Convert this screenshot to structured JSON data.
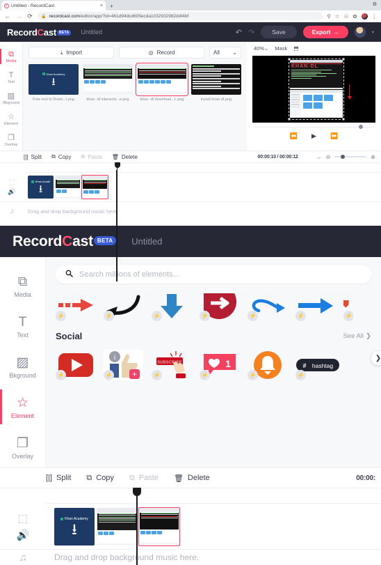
{
  "browser": {
    "tab": {
      "title": "Untitled - RecordCast",
      "favicon": "recordcast-favicon",
      "close": "×"
    },
    "new_tab": "+",
    "window_control": "⚙",
    "nav": {
      "back": "←",
      "forward": "→",
      "reload": "⟳"
    },
    "omnibox": {
      "lock_icon": "🔒",
      "url_prefix": "recordcast.com",
      "url_suffix": "/editor/app/?id=461d94dcd605ecda1032932982d4f4bf"
    },
    "toolbar_icons": [
      "key-icon",
      "star-icon",
      "person-icon",
      "extensions-icon",
      "profile-avatar",
      "more-menu-icon"
    ]
  },
  "header": {
    "logo_pre": "Record",
    "logo_c": "C",
    "logo_post": "ast",
    "beta": "BETA",
    "project_title": "Untitled",
    "undo_icon": "↶",
    "redo_icon": "↷",
    "save_label": "Save",
    "export_label": "Export",
    "export_arrow": "→",
    "avatar": "user-avatar",
    "caret": "▾"
  },
  "sidebar": {
    "items": [
      {
        "label": "Media",
        "glyph": "⧉",
        "name": "media"
      },
      {
        "label": "Text",
        "glyph": "T",
        "name": "text"
      },
      {
        "label": "Bkground",
        "glyph": "▨",
        "name": "bkground"
      },
      {
        "label": "Element",
        "glyph": "☆",
        "name": "element"
      },
      {
        "label": "Overlay",
        "glyph": "❐",
        "name": "overlay"
      }
    ],
    "active_top": "Media",
    "active_bottom": "Element"
  },
  "media_panel": {
    "import_label": "Import",
    "import_icon": "⤓",
    "record_label": "Record",
    "record_icon": "◎",
    "filter_value": "All",
    "filter_caret": "⌄",
    "files": [
      {
        "caption": "Free tool to Down...l.png",
        "selected": false,
        "kind": "khan-card"
      },
      {
        "caption": "khan -dl interactiv...e.png",
        "selected": false,
        "kind": "terminal-light"
      },
      {
        "caption": "khan -dl download...L.png",
        "selected": true,
        "kind": "terminal-files"
      },
      {
        "caption": "install khan-dl.png",
        "selected": false,
        "kind": "terminal-rows"
      }
    ]
  },
  "preview": {
    "zoom_value": "40%",
    "zoom_caret": "⌄",
    "mask_label": "Mask",
    "crop_icon": "⬒",
    "prev_icon": "⏪",
    "play_icon": "▶",
    "next_icon": "⏩"
  },
  "timeline": {
    "split_label": "Split",
    "split_icon": "[|]",
    "copy_label": "Copy",
    "copy_icon": "⧉",
    "paste_label": "Paste",
    "paste_icon": "⧉",
    "delete_label": "Delete",
    "delete_icon": "🗑",
    "time_display": "00:00:10 / 00:00:12",
    "time_display_clipped": "00:00:",
    "fit_icon": "↔",
    "zoom_out_icon": "⊖",
    "zoom_in_icon": "⊕",
    "video_track_icon": "⬚",
    "audio_track_icon": "🔊",
    "music_track_icon": "♫",
    "music_hint": "Drag and drop background music here.",
    "clips": [
      {
        "kind": "khan-card",
        "selected": false
      },
      {
        "kind": "terminal-light",
        "selected": false
      },
      {
        "kind": "terminal-files",
        "selected": true
      }
    ]
  },
  "element_panel": {
    "search_icon": "search-icon",
    "search_placeholder": "Search millions of elements...",
    "search_value": "",
    "arrows_row": [
      {
        "name": "dashed-red-arrow-right",
        "badge": "⚡"
      },
      {
        "name": "black-curved-arrow",
        "badge": "⚡"
      },
      {
        "name": "blue-arrow-down",
        "badge": "⚡"
      },
      {
        "name": "red-circle-arrow-right",
        "badge": "⚡"
      },
      {
        "name": "blue-loop-arrow-right",
        "badge": "⚡"
      },
      {
        "name": "blue-straight-arrow",
        "badge": "⚡"
      },
      {
        "name": "orange-arrow-partial",
        "badge": "⚡"
      }
    ],
    "section_title": "Social",
    "see_all_label": "See All",
    "see_all_caret": "❯",
    "social_row": [
      {
        "name": "youtube-play-button",
        "badge": "⚡",
        "label": ""
      },
      {
        "name": "thumbs-up-info-plus",
        "badge": "⚡",
        "label": "+"
      },
      {
        "name": "subscribe-button-hand",
        "badge": "⚡",
        "label": "SUBSCRIBE"
      },
      {
        "name": "heart-like-counter",
        "badge": "⚡",
        "label": "1"
      },
      {
        "name": "notification-bell",
        "badge": "⚡",
        "label": ""
      },
      {
        "name": "hashtag-pill",
        "badge": "⚡",
        "label": "hashtag",
        "hash": "#"
      }
    ],
    "next_arrow": "❯"
  }
}
